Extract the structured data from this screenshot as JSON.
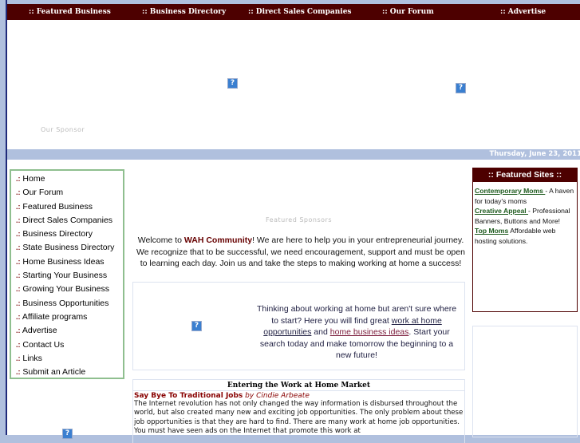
{
  "nav": [
    "::  Featured Business",
    "::  Business Directory",
    "::  Direct Sales Companies",
    "::  Our Forum",
    "::  Advertise"
  ],
  "header": {
    "sponsor_label": "Our Sponsor",
    "date": "Thursday, June 23, 2011",
    "broken_image_icon": "?"
  },
  "sidebar": {
    "bullet": ".:",
    "items": [
      "Home",
      "Our Forum",
      "Featured Business",
      "Direct Sales Companies",
      "Business Directory",
      "State Business Directory",
      "Home Business Ideas",
      "Starting Your Business",
      "Growing Your Business",
      "Business Opportunities",
      "Affiliate programs",
      "Advertise",
      "Contact Us",
      "Links",
      "Submit an Article"
    ]
  },
  "main": {
    "featured_sponsors": "Featured Sponsors",
    "welcome_pre": "Welcome to ",
    "welcome_brand": "WAH Community",
    "welcome_post": "! We are here to help you in your entrepreneurial journey. We recognize that to be successful, we need encouragement, support and must be open to learning each day. Join us and take the steps to making working at home a success!",
    "box_pre": "Thinking about working at home but aren't sure where to start? Here you will find great ",
    "box_link1": "work at home opportunities",
    "box_mid": " and ",
    "box_link2": "home business ideas",
    "box_post": ". Start your search today and make tomorrow the beginning to a new future!",
    "article": {
      "section_title": "Entering the Work at Home Market",
      "title": "Say Bye To Traditional Jobs",
      "byline": "by Cindie Arbeate",
      "body": "The Internet revolution has not only changed the way information is disbursed throughout the world, but also created many new and exciting job opportunities. The only problem about these job opportunities is that they are hard to find. There are many work at home job opportunities. You must have seen ads on the Internet that promote this work at"
    }
  },
  "featured_sites": {
    "title": ":: Featured Sites ::",
    "items": [
      {
        "name": "Contemporary Moms ",
        "desc": " - A haven for today's moms"
      },
      {
        "name": "Creative Appeal ",
        "desc": " - Professional Banners, Buttons and More!"
      },
      {
        "name": "Top Moms",
        "desc": " Affordable web hosting solutions."
      }
    ]
  },
  "colors": {
    "nav_bg": "#4d0000",
    "page_bg": "#b0c0de",
    "link_green": "#1d5a1d"
  }
}
